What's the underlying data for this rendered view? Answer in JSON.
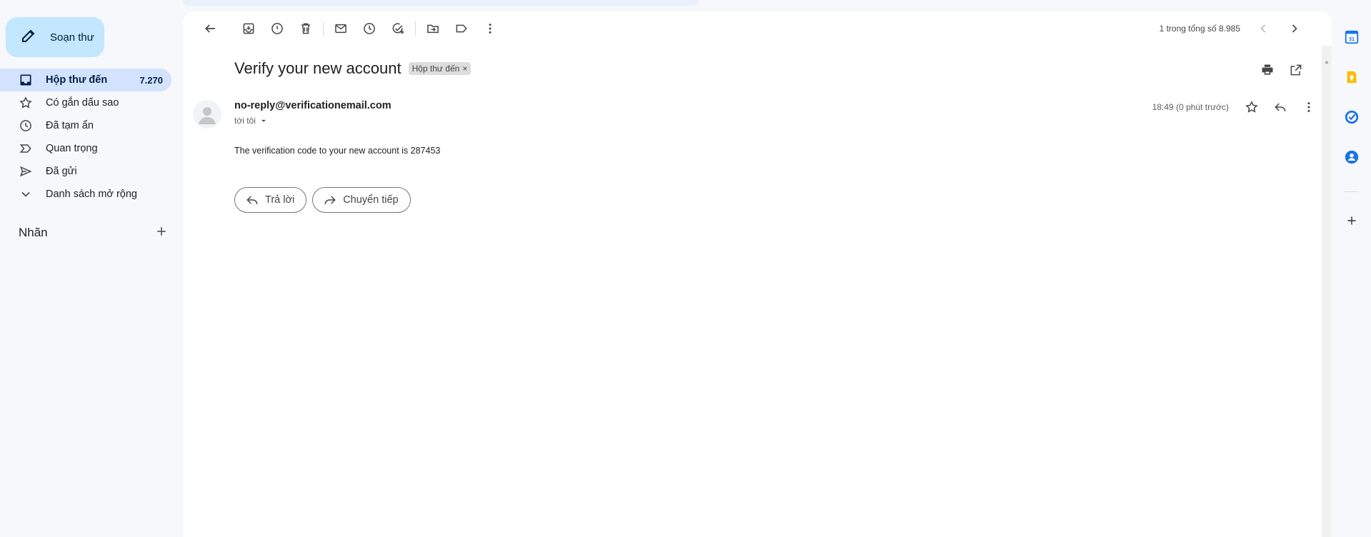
{
  "compose": {
    "label": "Soạn thư"
  },
  "nav": [
    {
      "label": "Hộp thư đến",
      "count": "7.270",
      "icon": "inbox-icon",
      "active": true
    },
    {
      "label": "Có gắn dấu sao",
      "count": "",
      "icon": "star-icon"
    },
    {
      "label": "Đã tạm ẩn",
      "count": "",
      "icon": "clock-icon"
    },
    {
      "label": "Quan trọng",
      "count": "",
      "icon": "important-icon"
    },
    {
      "label": "Đã gửi",
      "count": "",
      "icon": "send-icon"
    },
    {
      "label": "Danh sách mở rộng",
      "count": "",
      "icon": "chevron-down-icon"
    }
  ],
  "labels": {
    "title": "Nhãn"
  },
  "toolbar": {
    "pager_text": "1 trong tổng số 8.985"
  },
  "message": {
    "subject": "Verify your new account",
    "label_chip": "Hộp thư đến",
    "label_chip_close": "×",
    "sender": "no-reply@verificationemail.com",
    "recipient": "tới tôi",
    "time": "18:49 (0 phút trước)",
    "body": "The verification code to your new account is 287453"
  },
  "actions": {
    "reply": "Trả lời",
    "forward": "Chuyển tiếp"
  },
  "colors": {
    "background": "#f6f8fc",
    "compose_bg": "#c2e7ff",
    "active_nav_bg": "#d3e3fd",
    "calendar_blue": "#1a73e8",
    "keep_yellow": "#fbbc04",
    "tasks_blue": "#1a73e8",
    "contacts_blue": "#1a73e8"
  },
  "sidepanel": {
    "calendar_day": "31"
  }
}
